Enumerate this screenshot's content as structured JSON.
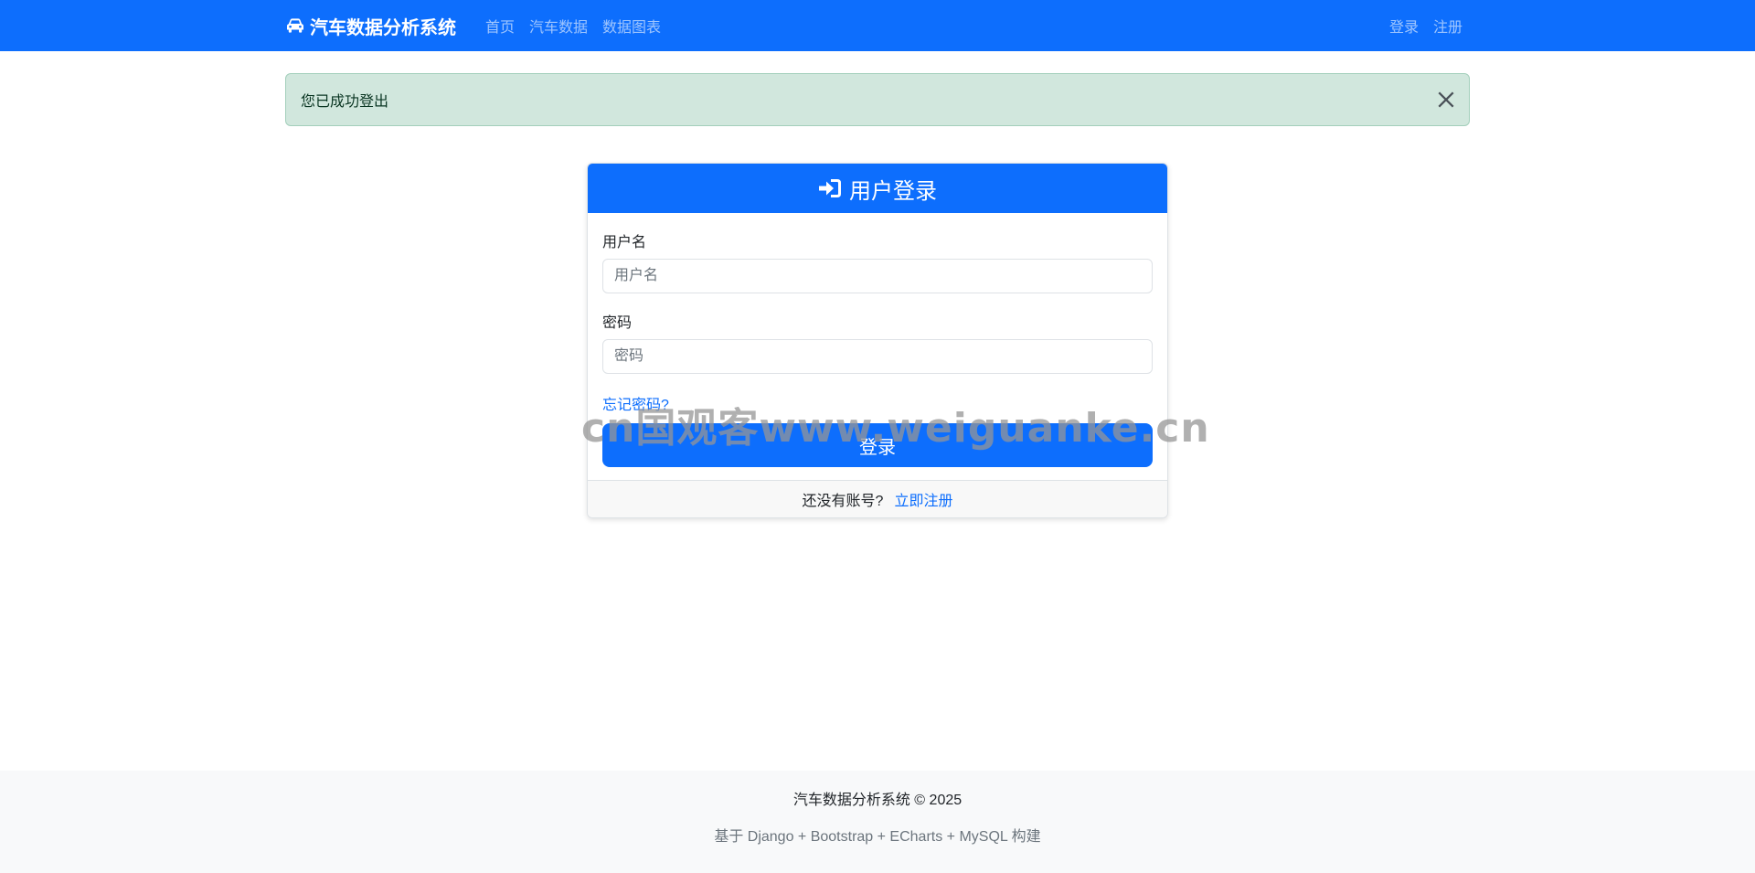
{
  "navbar": {
    "brand": "汽车数据分析系统",
    "links": [
      "首页",
      "汽车数据",
      "数据图表"
    ],
    "login": "登录",
    "register": "注册",
    "color": "#0d6efd"
  },
  "alert": {
    "message": "您已成功登出"
  },
  "login_card": {
    "title": "用户登录",
    "username_label": "用户名",
    "username_placeholder": "用户名",
    "password_label": "密码",
    "password_placeholder": "密码",
    "forgot_password": "忘记密码?",
    "submit": "登录",
    "no_account": "还没有账号?",
    "register_link": "立即注册"
  },
  "watermark": "cn国观客www.weiguanke.cn",
  "footer": {
    "line1": "汽车数据分析系统 © 2025",
    "line2": "基于 Django + Bootstrap + ECharts + MySQL 构建"
  },
  "icons": {
    "brand": "car-icon",
    "title": "sign-in-icon",
    "close": "close-icon"
  }
}
